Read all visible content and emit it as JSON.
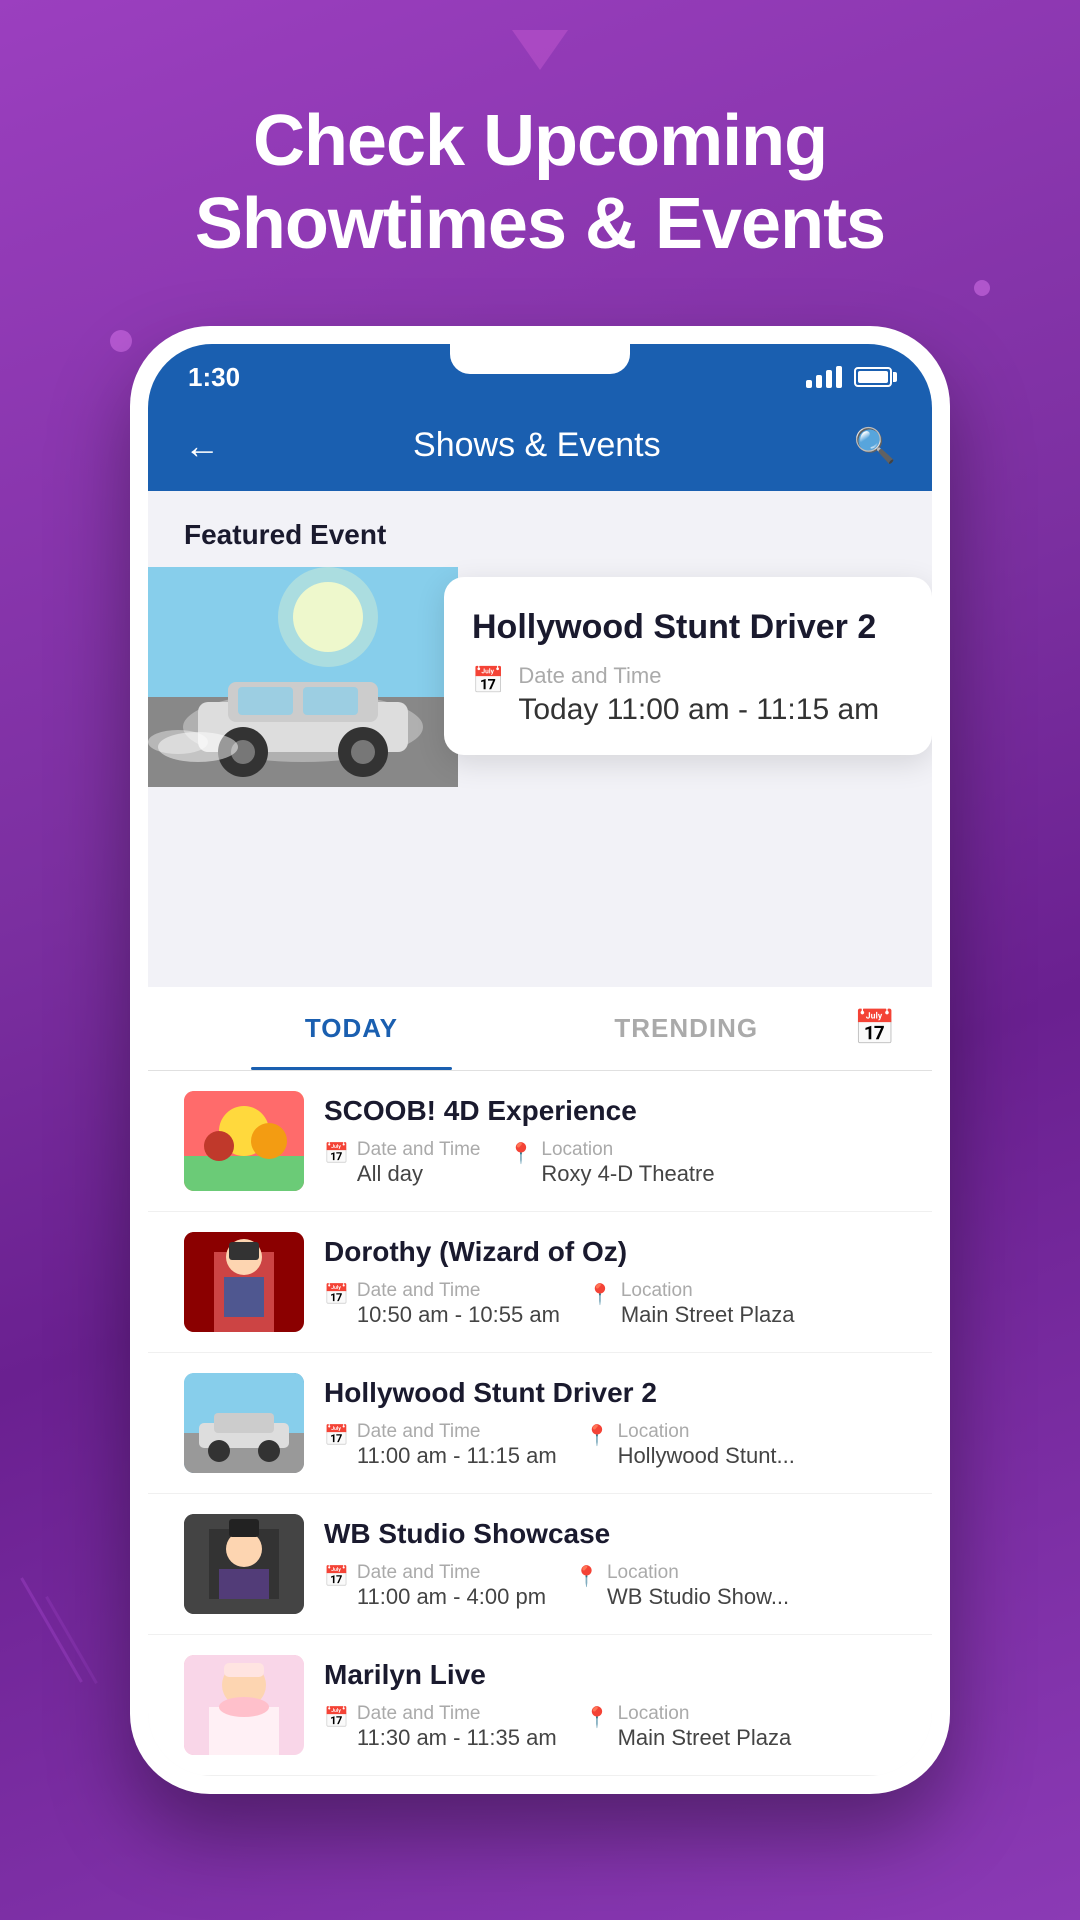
{
  "background": {
    "color_start": "#9b3fbf",
    "color_end": "#6a2090"
  },
  "page": {
    "headline_line1": "Check Upcoming",
    "headline_line2": "Showtimes & Events"
  },
  "phone": {
    "status_bar": {
      "time": "1:30"
    },
    "header": {
      "back_label": "←",
      "title": "Shows & Events",
      "search_label": "🔍"
    },
    "featured_section": {
      "label": "Featured Event",
      "event": {
        "name": "Hollywood Stunt Driver 2",
        "date_time_label": "Date and Time",
        "date_time_value": "Today  11:00 am - 11:15 am"
      }
    },
    "tabs": [
      {
        "id": "today",
        "label": "TODAY",
        "active": true
      },
      {
        "id": "trending",
        "label": "TRENDING",
        "active": false
      }
    ],
    "events": [
      {
        "id": "scoob",
        "name": "SCOOB! 4D Experience",
        "date_time_label": "Date and Time",
        "date_time_value": "All day",
        "location_label": "Location",
        "location_value": "Roxy 4-D Theatre",
        "thumb_class": "thumb-scoob"
      },
      {
        "id": "dorothy",
        "name": "Dorothy (Wizard of Oz)",
        "date_time_label": "Date and Time",
        "date_time_value": "10:50 am - 10:55 am",
        "location_label": "Location",
        "location_value": "Main Street Plaza",
        "thumb_class": "thumb-dorothy"
      },
      {
        "id": "stunt",
        "name": "Hollywood Stunt Driver 2",
        "date_time_label": "Date and Time",
        "date_time_value": "11:00 am - 11:15 am",
        "location_label": "Location",
        "location_value": "Hollywood Stunt...",
        "thumb_class": "thumb-stunt"
      },
      {
        "id": "wb",
        "name": "WB Studio Showcase",
        "date_time_label": "Date and Time",
        "date_time_value": "11:00 am - 4:00 pm",
        "location_label": "Location",
        "location_value": "WB Studio Show...",
        "thumb_class": "thumb-wb"
      },
      {
        "id": "marilyn",
        "name": "Marilyn Live",
        "date_time_label": "Date and Time",
        "date_time_value": "11:30 am - 11:35 am",
        "location_label": "Location",
        "location_value": "Main Street Plaza",
        "thumb_class": "thumb-marilyn"
      }
    ]
  }
}
